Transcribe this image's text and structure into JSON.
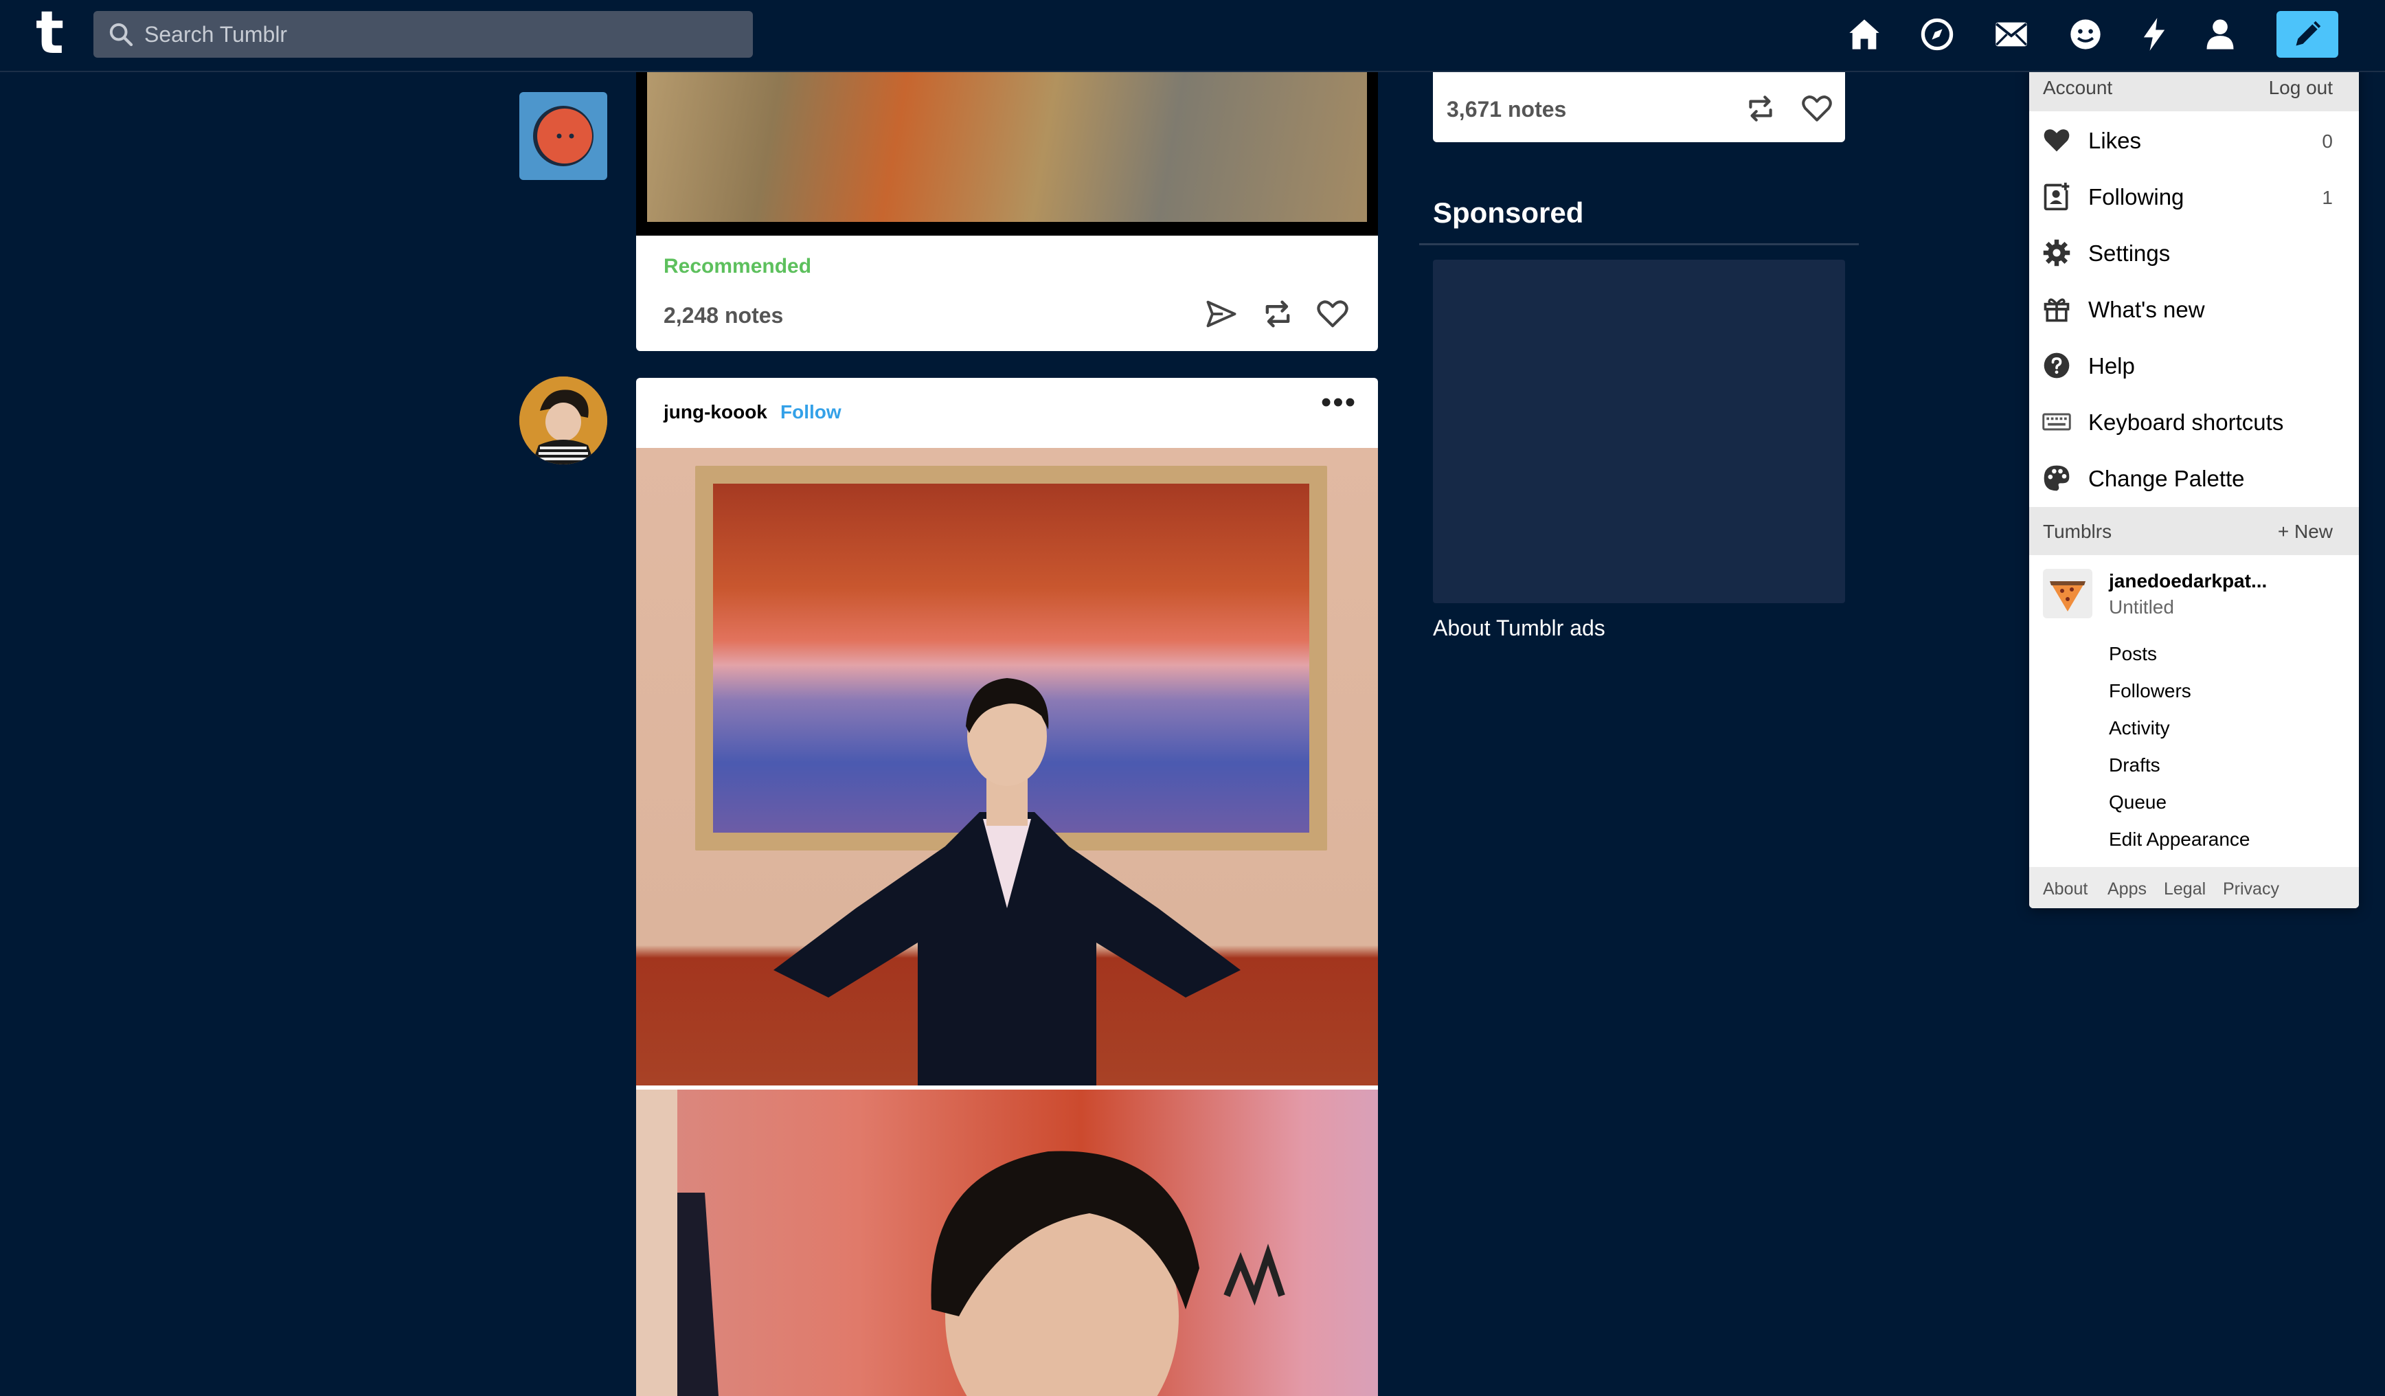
{
  "header": {
    "logo": "t",
    "search_placeholder": "Search Tumblr",
    "nav_icons": [
      "home-icon",
      "explore-icon",
      "inbox-icon",
      "messages-icon",
      "activity-icon",
      "account-icon"
    ],
    "compose_icon": "pencil-icon"
  },
  "posts": {
    "top": {
      "recommended": "Recommended",
      "notes": "2,248 notes"
    },
    "main": {
      "blog_name": "jung-koook",
      "follow_label": "Follow",
      "more_label": "•••"
    }
  },
  "sidebar": {
    "notes": "3,671 notes",
    "sponsored": "Sponsored",
    "about_ads": "About Tumblr ads"
  },
  "account_menu": {
    "header_label": "Account",
    "logout_label": "Log out",
    "items": [
      {
        "icon": "heart-icon",
        "label": "Likes",
        "count": "0"
      },
      {
        "icon": "following-icon",
        "label": "Following",
        "count": "1"
      },
      {
        "icon": "gear-icon",
        "label": "Settings",
        "count": ""
      },
      {
        "icon": "gift-icon",
        "label": "What's new",
        "count": ""
      },
      {
        "icon": "help-icon",
        "label": "Help",
        "count": ""
      },
      {
        "icon": "keyboard-icon",
        "label": "Keyboard shortcuts",
        "count": ""
      },
      {
        "icon": "palette-icon",
        "label": "Change Palette",
        "count": ""
      }
    ],
    "tumblrs_label": "Tumblrs",
    "new_label": "+ New",
    "blog": {
      "name": "janedoedarkpat...",
      "title": "Untitled",
      "links": [
        "Posts",
        "Followers",
        "Activity",
        "Drafts",
        "Queue",
        "Edit Appearance"
      ]
    },
    "footer": [
      "About",
      "Apps",
      "Legal",
      "Privacy"
    ]
  },
  "colors": {
    "background": "#001935",
    "accent": "#4cc3fa",
    "follow": "#34a1e8",
    "recommended": "#5dc05d"
  }
}
